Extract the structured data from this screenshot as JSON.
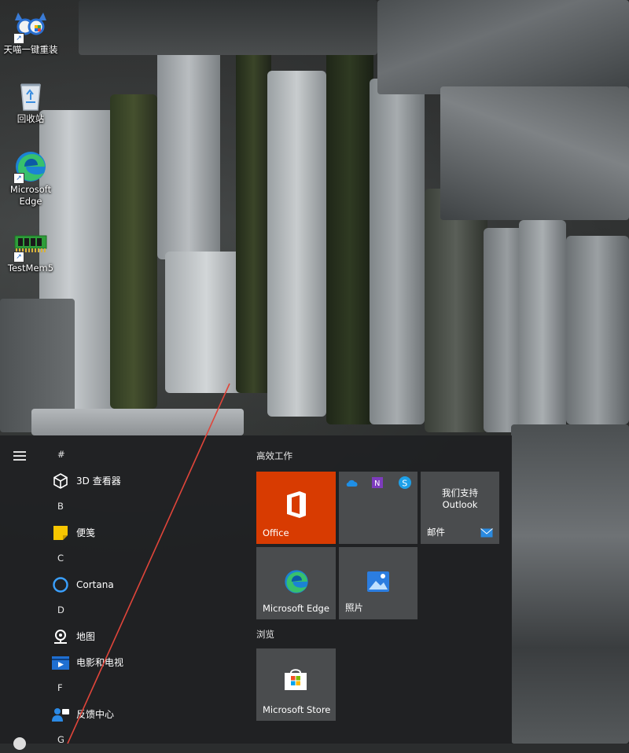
{
  "desktop": {
    "icons": [
      {
        "label": "天喵一键重装",
        "icon": "tianmiao-installer-icon"
      },
      {
        "label": "回收站",
        "icon": "recycle-bin-icon"
      },
      {
        "label": "Microsoft Edge",
        "icon": "edge-icon"
      },
      {
        "label": "TestMem5",
        "icon": "memory-chip-icon"
      }
    ]
  },
  "start_menu": {
    "app_list": [
      {
        "type": "letter",
        "text": "#"
      },
      {
        "type": "app",
        "text": "3D 查看器",
        "icon": "cube-icon"
      },
      {
        "type": "letter",
        "text": "B"
      },
      {
        "type": "app",
        "text": "便笺",
        "icon": "sticky-notes-icon"
      },
      {
        "type": "letter",
        "text": "C"
      },
      {
        "type": "app",
        "text": "Cortana",
        "icon": "cortana-icon"
      },
      {
        "type": "letter",
        "text": "D"
      },
      {
        "type": "app",
        "text": "地图",
        "icon": "maps-icon"
      },
      {
        "type": "app",
        "text": "电影和电视",
        "icon": "movies-tv-icon"
      },
      {
        "type": "letter",
        "text": "F"
      },
      {
        "type": "app",
        "text": "反馈中心",
        "icon": "feedback-hub-icon"
      },
      {
        "type": "letter",
        "text": "G"
      }
    ],
    "groups": [
      {
        "title": "高效工作"
      },
      {
        "title": "浏览"
      }
    ],
    "tiles": {
      "office": "Office",
      "mail_promo": "我们支持\nOutlook",
      "mail": "邮件",
      "edge": "Microsoft Edge",
      "photos": "照片",
      "store": "Microsoft Store"
    }
  },
  "colors": {
    "office_tile": "#d83b01",
    "tile_gray": "#505254",
    "annotation_line": "#e0453a"
  }
}
